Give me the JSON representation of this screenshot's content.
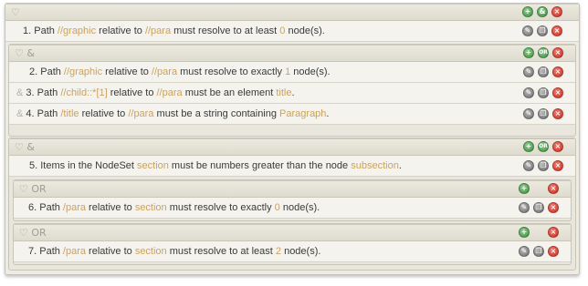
{
  "root": {
    "label": "",
    "actions": {
      "add": "+",
      "and": "&",
      "delete": "x"
    }
  },
  "rows": [
    {
      "num": "1.",
      "parts": [
        {
          "t": "Path "
        },
        {
          "t": "//graphic",
          "k": 1
        },
        {
          "t": " relative to "
        },
        {
          "t": "//para",
          "k": 1
        },
        {
          "t": " must resolve to at least "
        },
        {
          "t": "0",
          "k": 1
        },
        {
          "t": " node(s)."
        }
      ]
    },
    {
      "num": "2.",
      "parts": [
        {
          "t": "Path "
        },
        {
          "t": "//graphic",
          "k": 1
        },
        {
          "t": " relative to "
        },
        {
          "t": "//para",
          "k": 1
        },
        {
          "t": " must resolve to exactly "
        },
        {
          "t": "1",
          "k": 1
        },
        {
          "t": " node(s)."
        }
      ]
    },
    {
      "num": "3.",
      "prefix": "&",
      "parts": [
        {
          "t": "Path "
        },
        {
          "t": "//child::*[1]",
          "k": 1
        },
        {
          "t": " relative to "
        },
        {
          "t": "//para",
          "k": 1
        },
        {
          "t": " must be an element "
        },
        {
          "t": "title",
          "k": 1
        },
        {
          "t": "."
        }
      ]
    },
    {
      "num": "4.",
      "prefix": "&",
      "parts": [
        {
          "t": "Path "
        },
        {
          "t": "/title",
          "k": 1
        },
        {
          "t": " relative to "
        },
        {
          "t": "//para",
          "k": 1
        },
        {
          "t": " must be a string containing "
        },
        {
          "t": "Paragraph",
          "k": 1
        },
        {
          "t": "."
        }
      ]
    },
    {
      "num": "5.",
      "parts": [
        {
          "t": "Items in the NodeSet "
        },
        {
          "t": "section",
          "k": 1
        },
        {
          "t": " must be numbers greater than the node "
        },
        {
          "t": "subsection",
          "k": 1
        },
        {
          "t": "."
        }
      ]
    },
    {
      "num": "6.",
      "parts": [
        {
          "t": "Path "
        },
        {
          "t": "/para",
          "k": 1
        },
        {
          "t": " relative to "
        },
        {
          "t": "section",
          "k": 1
        },
        {
          "t": " must resolve to exactly "
        },
        {
          "t": "0",
          "k": 1
        },
        {
          "t": " node(s)."
        }
      ]
    },
    {
      "num": "7.",
      "parts": [
        {
          "t": "Path "
        },
        {
          "t": "/para",
          "k": 1
        },
        {
          "t": " relative to "
        },
        {
          "t": "section",
          "k": 1
        },
        {
          "t": " must resolve to at least "
        },
        {
          "t": "2",
          "k": 1
        },
        {
          "t": " node(s)."
        }
      ]
    }
  ],
  "groups": {
    "and1": "&",
    "and2": "&",
    "or1": "OR",
    "or2": "OR"
  },
  "row_actions": {
    "edit": "edit",
    "copy": "copy",
    "delete": "x"
  },
  "group_actions": {
    "add": "+",
    "or": "OR",
    "delete": "x"
  },
  "colors": {
    "keyword": "#cfa25a",
    "green": "#3c8e3c",
    "red": "#cc2a1c"
  }
}
